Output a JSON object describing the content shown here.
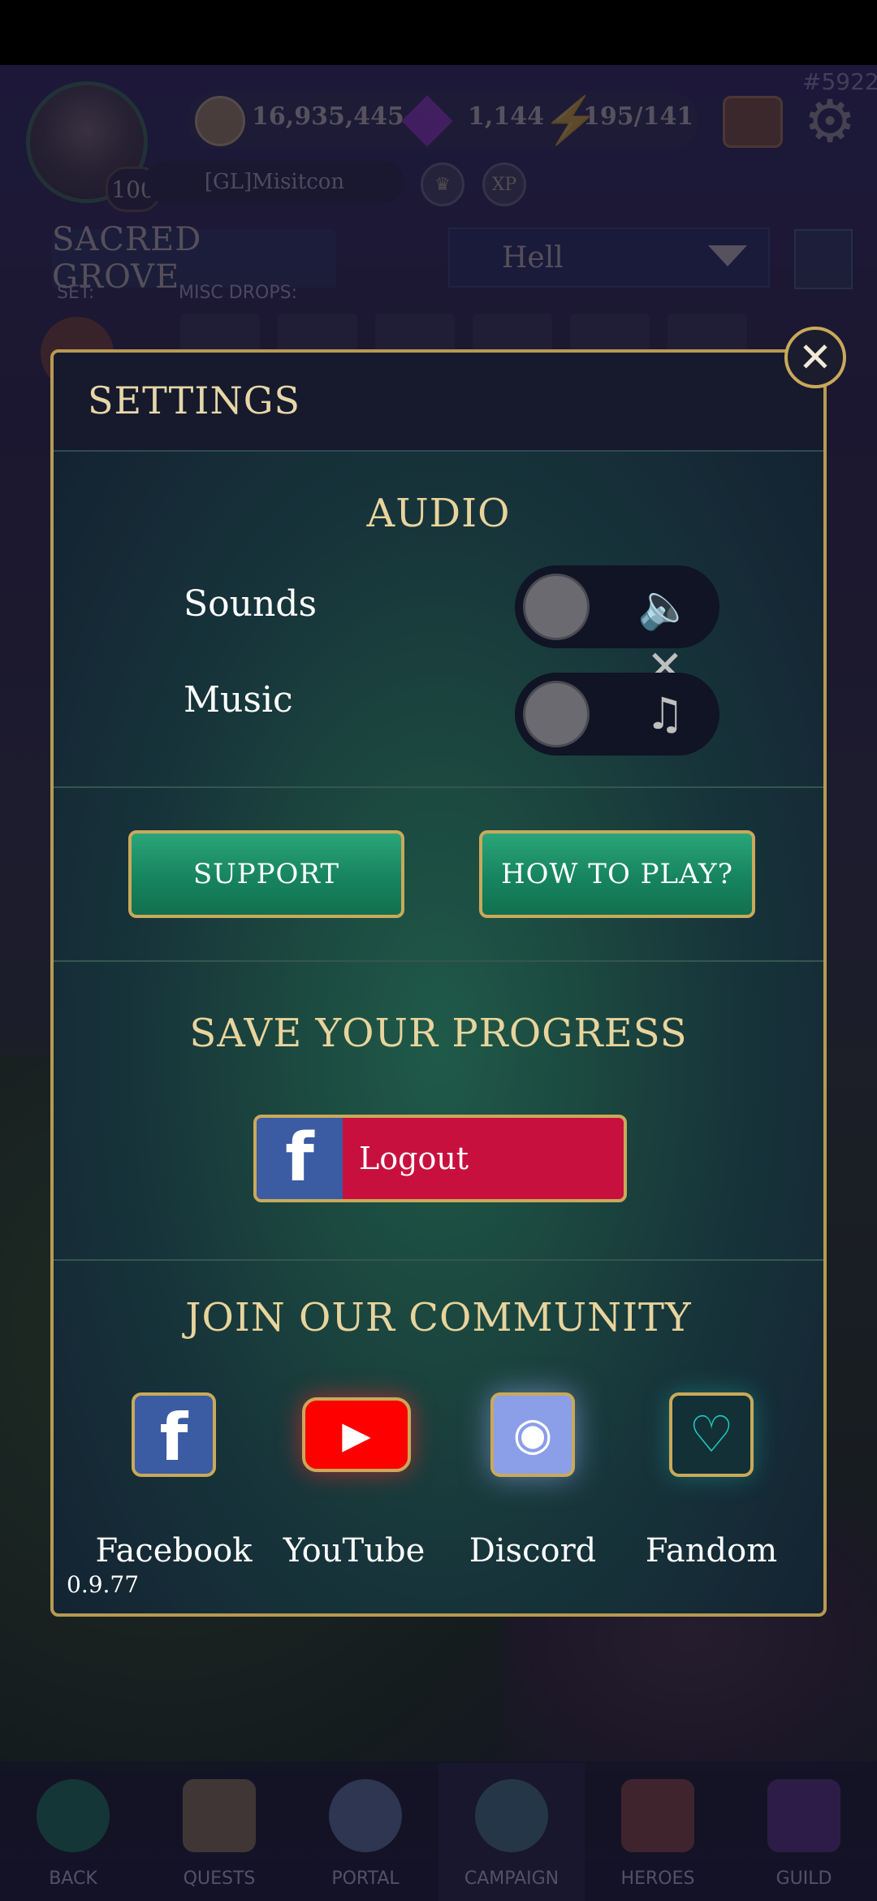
{
  "hud": {
    "player_id": "#5922",
    "gold": "16,935,445",
    "gems": "1,144",
    "energy": "195/141",
    "level": "100",
    "player_name": "[GL]Misitcon",
    "xp_badge": "XP",
    "location": "SACRED GROVE",
    "difficulty": "Hell",
    "set_label": "SET:",
    "misc_drops_label": "MISC DROPS:"
  },
  "settings": {
    "title": "SETTINGS",
    "close_glyph": "✕",
    "audio": {
      "title": "AUDIO",
      "sounds_label": "Sounds",
      "music_label": "Music",
      "sounds_on": false,
      "music_on": false,
      "sounds_icon": "🔈✕",
      "music_icon": "♫"
    },
    "buttons": {
      "support": "SUPPORT",
      "how_to_play": "HOW TO PLAY?"
    },
    "progress": {
      "title": "SAVE YOUR PROGRESS",
      "fb_glyph": "f",
      "logout_label": "Logout"
    },
    "community": {
      "title": "JOIN OUR COMMUNITY",
      "links": [
        {
          "label": "Facebook",
          "icon": "facebook-icon",
          "glyph": "f"
        },
        {
          "label": "YouTube",
          "icon": "youtube-icon",
          "glyph": "▶"
        },
        {
          "label": "Discord",
          "icon": "discord-icon",
          "glyph": "◉"
        },
        {
          "label": "Fandom",
          "icon": "fandom-icon",
          "glyph": "♡"
        }
      ]
    },
    "version": "0.9.77"
  },
  "bottom_nav": [
    {
      "label": "BACK",
      "icon": "back-arrow-icon"
    },
    {
      "label": "QUESTS",
      "icon": "scroll-icon"
    },
    {
      "label": "PORTAL",
      "icon": "portal-icon"
    },
    {
      "label": "CAMPAIGN",
      "icon": "globe-icon"
    },
    {
      "label": "HEROES",
      "icon": "cards-icon"
    },
    {
      "label": "GUILD",
      "icon": "banner-icon"
    }
  ],
  "colors": {
    "gold_border": "#c9a95a",
    "title_gold": "#e8d49c",
    "button_green": "#17845f",
    "facebook_blue": "#3b5ba3",
    "logout_red": "#c8103f",
    "youtube_red": "#ff0000",
    "discord_blue": "#8b9ee8",
    "fandom_teal": "#1fc9c0"
  }
}
